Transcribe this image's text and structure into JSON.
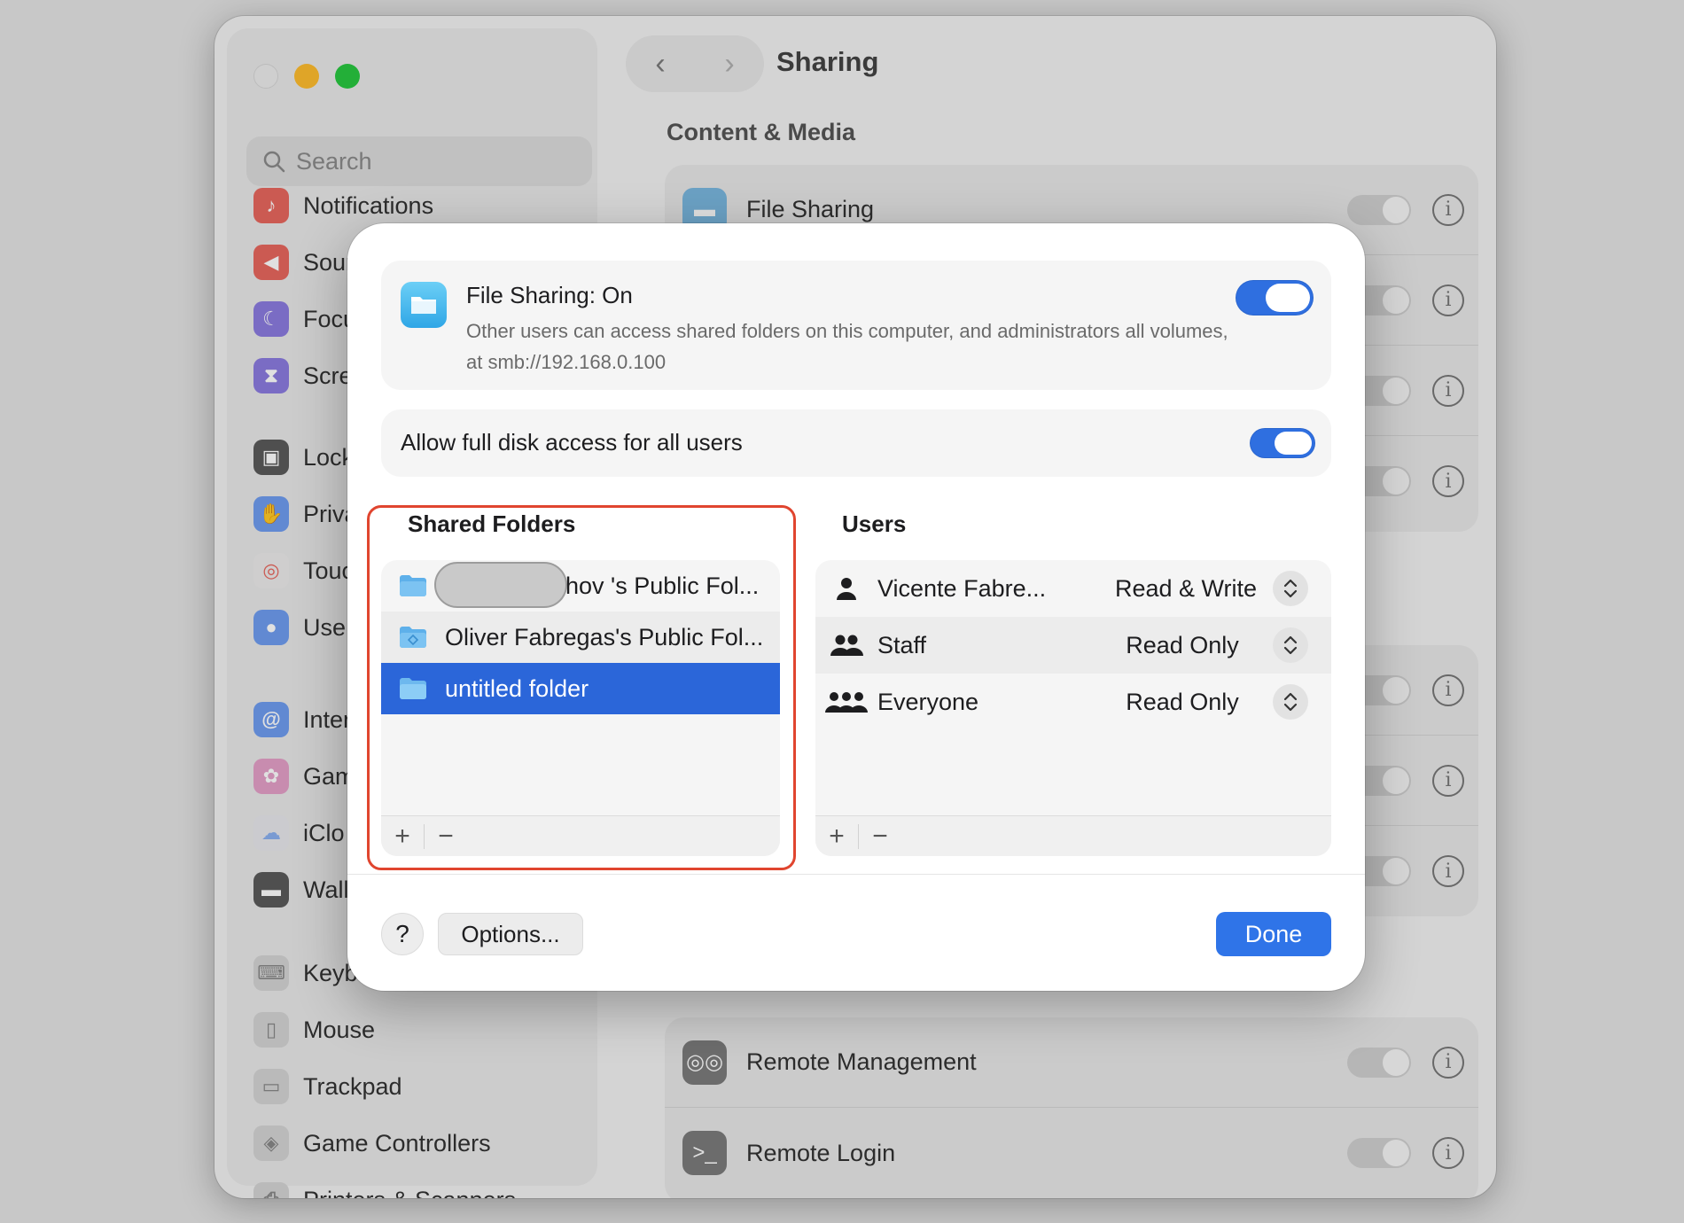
{
  "window": {
    "title": "Sharing"
  },
  "sidebar": {
    "search_placeholder": "Search",
    "items": [
      {
        "label": "Notifications",
        "icon": "bell-icon",
        "color": "#e8675e"
      },
      {
        "label": "Sour",
        "icon": "speaker-icon",
        "color": "#e8675e"
      },
      {
        "label": "Focu",
        "icon": "moon-icon",
        "color": "#8b7be0"
      },
      {
        "label": "Scre",
        "icon": "hourglass-icon",
        "color": "#8b7be0"
      },
      {
        "label": "Lock",
        "icon": "lock-icon",
        "color": "#5a5a5a"
      },
      {
        "label": "Priva",
        "icon": "hand-icon",
        "color": "#6f9cf0"
      },
      {
        "label": "Touc",
        "icon": "fingerprint-icon",
        "color": "#ecebeb"
      },
      {
        "label": "Use",
        "icon": "users-icon",
        "color": "#6f9cf0"
      },
      {
        "label": "Inter",
        "icon": "at-icon",
        "color": "#6f9cf0"
      },
      {
        "label": "Gam",
        "icon": "game-center-icon",
        "color": "#e4a0c8"
      },
      {
        "label": "iClo",
        "icon": "cloud-icon",
        "color": "#e8e8ec"
      },
      {
        "label": "Wall",
        "icon": "wallet-icon",
        "color": "#5a5a5a"
      },
      {
        "label": "Keyb",
        "icon": "keyboard-icon",
        "color": "#d4d4d4"
      },
      {
        "label": "Mouse",
        "icon": "mouse-icon",
        "color": "#d4d4d4"
      },
      {
        "label": "Trackpad",
        "icon": "trackpad-icon",
        "color": "#d4d4d4"
      },
      {
        "label": "Game Controllers",
        "icon": "gamepad-icon",
        "color": "#d4d4d4"
      },
      {
        "label": "Printers & Scanners",
        "icon": "printer-icon",
        "color": "#d4d4d4"
      }
    ]
  },
  "main": {
    "section": "Content & Media",
    "rows": [
      {
        "label": "File Sharing",
        "icon": "folder-icon"
      },
      {
        "label": "Remote Management",
        "icon": "binoculars-icon"
      },
      {
        "label": "Remote Login",
        "icon": "terminal-icon"
      }
    ]
  },
  "dialog": {
    "file_sharing": {
      "title": "File Sharing: On",
      "description": "Other users can access shared folders on this computer, and administrators all volumes, at smb://192.168.0.100",
      "enabled": true
    },
    "full_disk": {
      "label": "Allow full disk access for all users",
      "enabled": true
    },
    "shared_folders": {
      "heading": "Shared Folders",
      "items": [
        {
          "label": "hov 's Public Fol...",
          "selected": false
        },
        {
          "label": "Oliver Fabregas's Public Fol...",
          "selected": false
        },
        {
          "label": "untitled folder",
          "selected": true
        }
      ]
    },
    "users": {
      "heading": "Users",
      "items": [
        {
          "name": "Vicente Fabre...",
          "permission": "Read & Write",
          "icon": "person-icon"
        },
        {
          "name": "Staff",
          "permission": "Read Only",
          "icon": "group-icon"
        },
        {
          "name": "Everyone",
          "permission": "Read Only",
          "icon": "everyone-icon"
        }
      ]
    },
    "add_label": "+",
    "remove_label": "−",
    "help_label": "?",
    "options_label": "Options...",
    "done_label": "Done"
  },
  "colors": {
    "accent": "#2f74e8",
    "selection": "#2b66d9",
    "highlight_outline": "#e0452f"
  }
}
